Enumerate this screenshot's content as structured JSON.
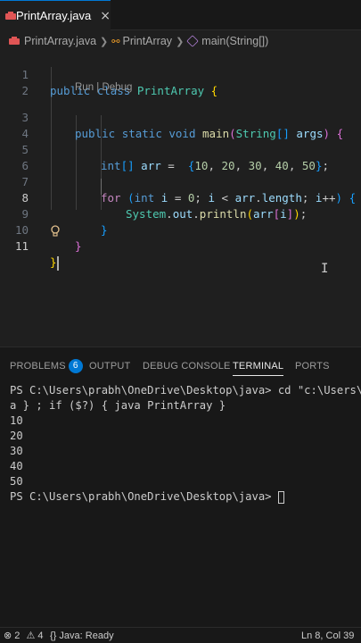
{
  "tab": {
    "label": "PrintArray.java",
    "close": "×"
  },
  "breadcrumb": {
    "file": "PrintArray.java",
    "class": "PrintArray",
    "method": "main(String[])"
  },
  "editor": {
    "codelens": "Run | Debug",
    "line_numbers": [
      "1",
      "2",
      "3",
      "4",
      "5",
      "6",
      "7",
      "8",
      "9",
      "10",
      "11"
    ],
    "code": {
      "l1_kw1": "public",
      "l1_kw2": "class",
      "l1_name": "PrintArray",
      "l1_brace": "{",
      "l3_kw1": "public",
      "l3_kw2": "static",
      "l3_kw3": "void",
      "l3_fn": "main",
      "l3_paren_open": "(",
      "l3_type": "String",
      "l3_brackets": "[]",
      "l3_param": "args",
      "l3_paren_close": ")",
      "l3_brace": "{",
      "l5_type": "int",
      "l5_brackets": "[]",
      "l5_var": "arr",
      "l5_eq": "=",
      "l5_open": "{",
      "l5_values": [
        "10",
        "20",
        "30",
        "40",
        "50"
      ],
      "l5_close": "}",
      "l5_semi": ";",
      "l7_kw": "for",
      "l7_open": "(",
      "l7_type": "int",
      "l7_i1": "i",
      "l7_eq": "=",
      "l7_zero": "0",
      "l7_i2": "i",
      "l7_lt": "<",
      "l7_arr": "arr",
      "l7_length": "length",
      "l7_i3": "i",
      "l7_inc": "++",
      "l7_close": ")",
      "l7_brace": "{",
      "l8_system": "System",
      "l8_out": "out",
      "l8_fn": "println",
      "l8_open": "(",
      "l8_arr": "arr",
      "l8_idx_open": "[",
      "l8_i": "i",
      "l8_idx_close": "]",
      "l8_close": ")",
      "l8_semi": ";",
      "l9_brace": "}",
      "l10_brace": "}",
      "l11_brace": "}"
    }
  },
  "panel": {
    "tabs": {
      "problems": "PROBLEMS",
      "problems_count": "6",
      "output": "OUTPUT",
      "debug_console": "DEBUG CONSOLE",
      "terminal": "TERMINAL",
      "ports": "PORTS"
    },
    "terminal_lines": [
      "PS C:\\Users\\prabh\\OneDrive\\Desktop\\java> cd \"c:\\Users\\prabh",
      "a } ; if ($?) { java PrintArray }",
      "10",
      "20",
      "30",
      "40",
      "50",
      "PS C:\\Users\\prabh\\OneDrive\\Desktop\\java> "
    ]
  },
  "status_bar": {
    "errors": "2",
    "warnings": "4",
    "java_status": "Java: Ready",
    "position": "Ln 8, Col 39"
  },
  "colors": {
    "accent": "#0078d4",
    "keyword": "#569cd6",
    "control": "#c586c0",
    "type": "#4ec9b0",
    "function": "#dcdcaa",
    "variable": "#9cdcfe",
    "number": "#b5cea8"
  }
}
